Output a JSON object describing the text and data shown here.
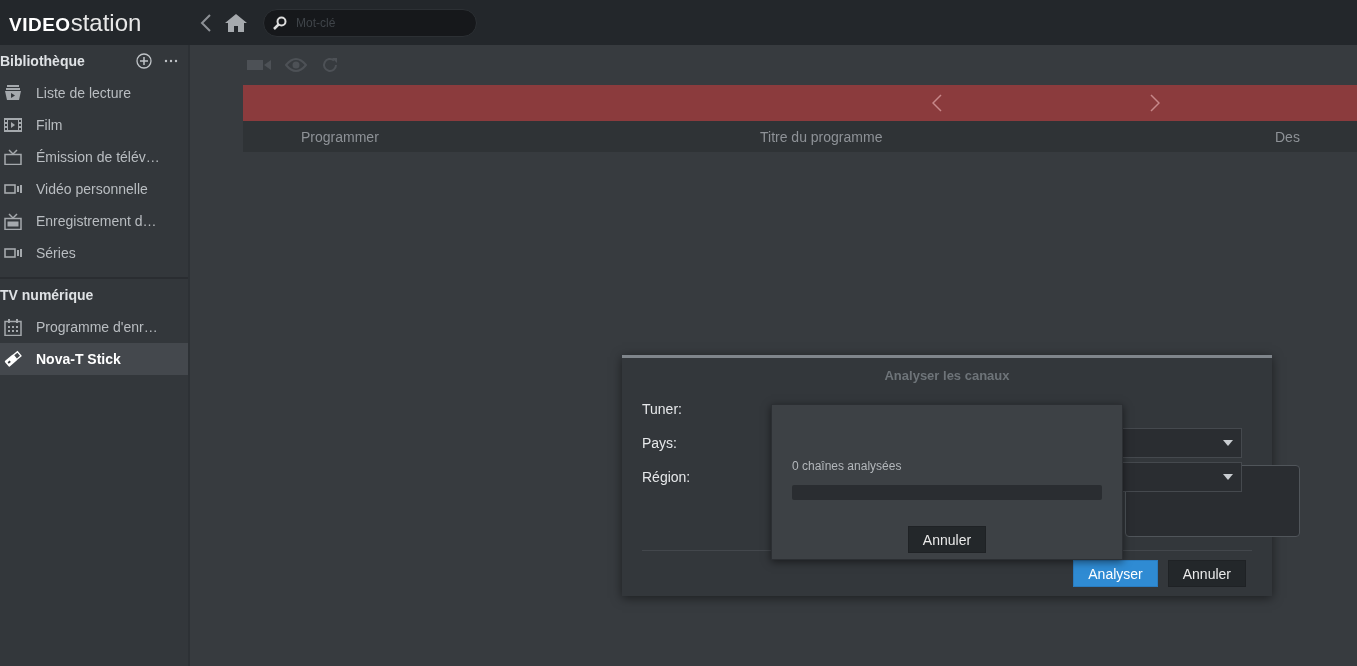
{
  "app": {
    "logo_bold": "VIDEO",
    "logo_light": "station"
  },
  "search": {
    "placeholder": "Mot-clé"
  },
  "sidebar": {
    "sections": [
      {
        "title": "Bibliothèque",
        "actions": true,
        "items": [
          {
            "label": "Liste de lecture",
            "kind": "playlist",
            "selected": false
          },
          {
            "label": "Film",
            "kind": "film",
            "selected": false
          },
          {
            "label": "Émission de télév…",
            "kind": "tv",
            "selected": false
          },
          {
            "label": "Vidéo personnelle",
            "kind": "video",
            "selected": false
          },
          {
            "label": "Enregistrement d…",
            "kind": "rec",
            "selected": false
          },
          {
            "label": "Séries",
            "kind": "video",
            "selected": false
          }
        ]
      },
      {
        "title": "TV numérique",
        "actions": false,
        "items": [
          {
            "label": "Programme d'enr…",
            "kind": "calendar",
            "selected": false
          },
          {
            "label": "Nova-T Stick",
            "kind": "usb",
            "selected": true
          }
        ]
      }
    ]
  },
  "table": {
    "columns": [
      "Programmer",
      "Titre du programme",
      "Des"
    ]
  },
  "dialog": {
    "title": "Analyser les canaux",
    "fields": [
      {
        "label": "Tuner:",
        "kind": "text"
      },
      {
        "label": "Pays:",
        "kind": "select"
      },
      {
        "label": "Région:",
        "kind": "select"
      }
    ],
    "buttons": [
      {
        "label": "Analyser",
        "primary": true
      },
      {
        "label": "Annuler",
        "primary": false
      }
    ]
  },
  "progress": {
    "status": "0 chaînes analysées",
    "level": 0,
    "button": "Annuler"
  }
}
